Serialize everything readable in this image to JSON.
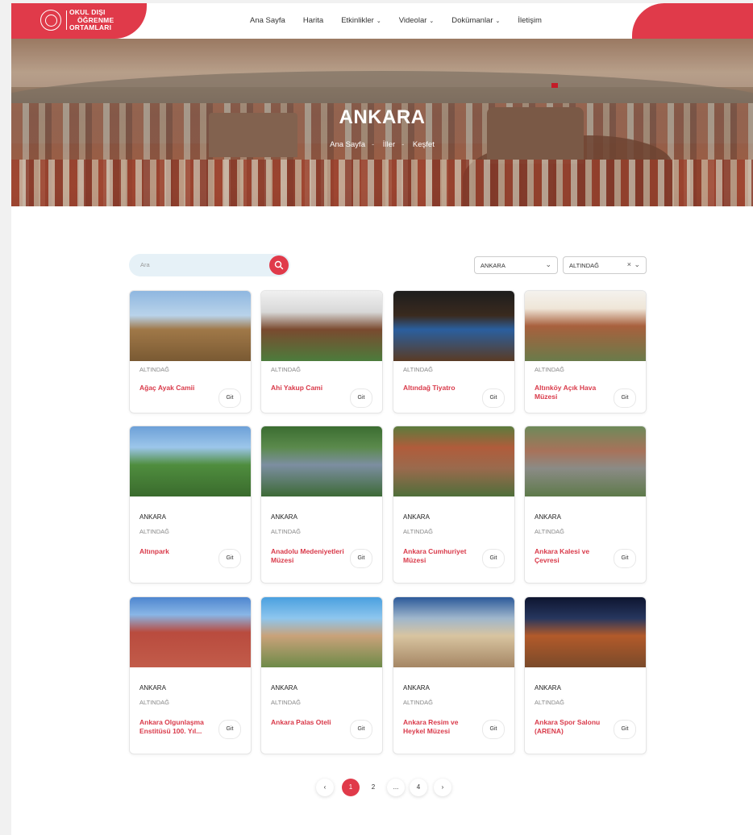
{
  "logo": {
    "line1": "OKUL DIŞI",
    "line2": "ÖĞRENME",
    "line3": "ORTAMLARI"
  },
  "nav": {
    "items": [
      {
        "label": "Ana Sayfa"
      },
      {
        "label": "Harita"
      },
      {
        "label": "Etkinlikler"
      },
      {
        "label": "Videolar"
      },
      {
        "label": "Dokümanlar"
      },
      {
        "label": "İletişim"
      }
    ]
  },
  "hero": {
    "title": "ANKARA",
    "breadcrumb": [
      "Ana Sayfa",
      "İller",
      "Keşfet"
    ]
  },
  "search": {
    "placeholder": "Ara"
  },
  "filters": {
    "province": "ANKARA",
    "district": "ALTINDAĞ"
  },
  "cards": [
    {
      "city": "",
      "district": "ALTINDAĞ",
      "title": "Ağaç Ayak Camii",
      "go": "Git"
    },
    {
      "city": "",
      "district": "ALTINDAĞ",
      "title": "Ahi Yakup Cami",
      "go": "Git"
    },
    {
      "city": "",
      "district": "ALTINDAĞ",
      "title": "Altındağ Tiyatro",
      "go": "Git"
    },
    {
      "city": "",
      "district": "ALTINDAĞ",
      "title": "Altınköy Açık Hava Müzesi",
      "go": "Git"
    },
    {
      "city": "ANKARA",
      "district": "ALTINDAĞ",
      "title": "Altınpark",
      "go": "Git"
    },
    {
      "city": "ANKARA",
      "district": "ALTINDAĞ",
      "title": "Anadolu Medeniyetleri Müzesi",
      "go": "Git"
    },
    {
      "city": "ANKARA",
      "district": "ALTINDAĞ",
      "title": "Ankara Cumhuriyet Müzesi",
      "go": "Git"
    },
    {
      "city": "ANKARA",
      "district": "ALTINDAĞ",
      "title": "Ankara Kalesi ve Çevresi",
      "go": "Git"
    },
    {
      "city": "ANKARA",
      "district": "ALTINDAĞ",
      "title": "Ankara Olgunlaşma Enstitüsü 100. Yıl...",
      "go": "Git"
    },
    {
      "city": "ANKARA",
      "district": "ALTINDAĞ",
      "title": "Ankara Palas Oteli",
      "go": "Git"
    },
    {
      "city": "ANKARA",
      "district": "ALTINDAĞ",
      "title": "Ankara Resim ve Heykel Müzesi",
      "go": "Git"
    },
    {
      "city": "ANKARA",
      "district": "ALTINDAĞ",
      "title": "Ankara Spor Salonu (ARENA)",
      "go": "Git"
    }
  ],
  "pagination": {
    "prev": "‹",
    "pages": [
      "1",
      "2",
      "...",
      "4"
    ],
    "next": "›",
    "current": "1"
  }
}
